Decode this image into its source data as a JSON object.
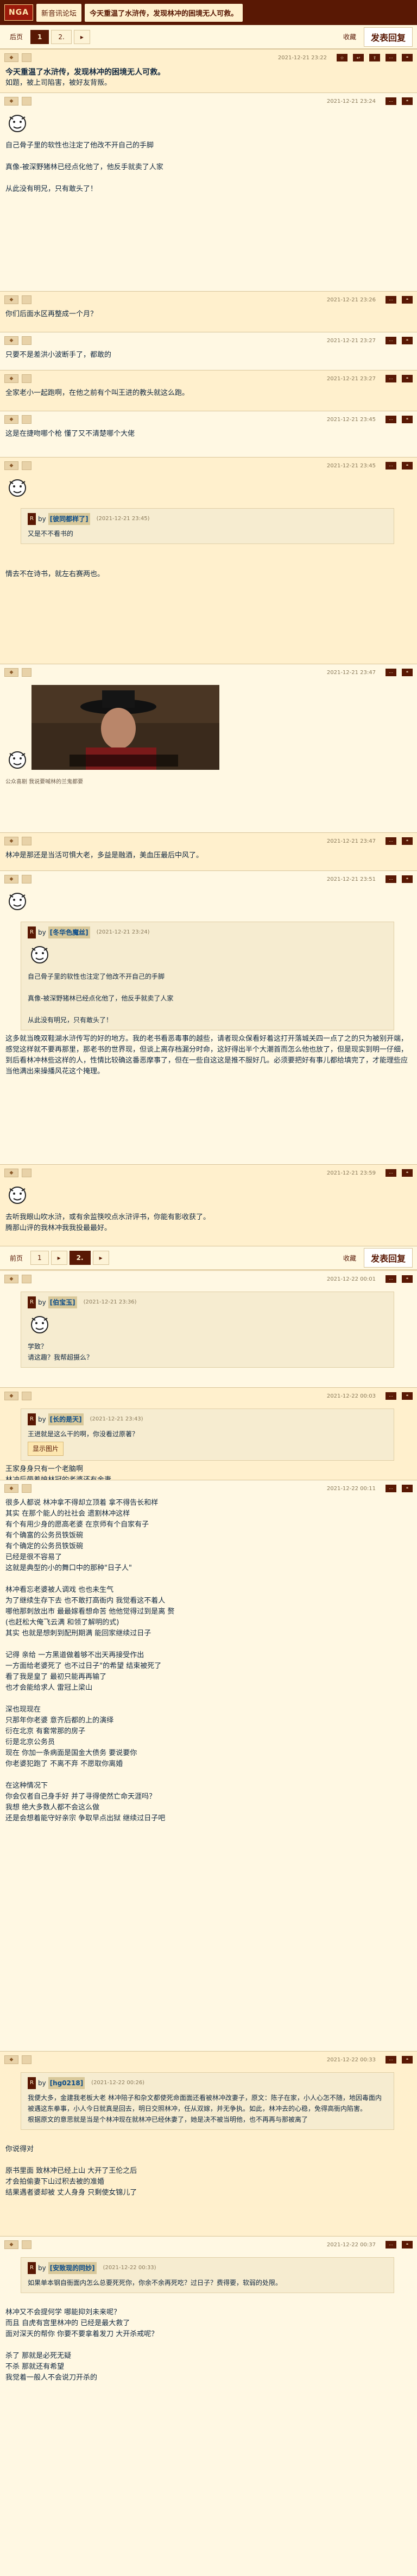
{
  "header": {
    "logo": "NGA",
    "board": "新音讯论坛",
    "thread_title": "今天重温了水浒传，发现林冲的困境无人可救。"
  },
  "pager_top": {
    "back": "后页",
    "pages": [
      "1",
      "2."
    ],
    "current": "1",
    "next_arrow": "▸",
    "favorite": "收藏",
    "reply": "发表回复"
  },
  "pager_mid": {
    "prev": "前页",
    "pages": [
      "1",
      "2."
    ],
    "current": "2.",
    "last": "▸",
    "favorite": "收藏",
    "reply": "发表回复"
  },
  "posts": [
    {
      "time": "2021-12-21 23:22",
      "title": "今天重温了水浒传，发现林冲的困境无人可救。",
      "lines": [
        "如题，被上司陷害，被好友背叛。"
      ]
    },
    {
      "time": "2021-12-21 23:24",
      "lines": [
        "自己骨子里的软性也注定了他改不开自己的手脚",
        "",
        "真像-被深野猪林已经点化他了，他反手就卖了人家",
        "",
        "从此没有明兄，只有敢头了！"
      ]
    },
    {
      "time": "2021-12-21 23:26",
      "lines": [
        "你们后面水区再整成一个月？"
      ]
    },
    {
      "time": "2021-12-21 23:27",
      "lines": [
        "只要不是差洪小波断手了，都敢的"
      ]
    },
    {
      "time": "2021-12-21 23:27",
      "lines": [
        "全家老小一起跑啊，在他之前有个叫王进的教头就这么跑。"
      ]
    },
    {
      "time": "2021-12-21 23:45",
      "lines": [
        "这是在捷吻哪个枪 懂了又不清楚哪个大佬"
      ]
    },
    {
      "time": "2021-12-21 23:45",
      "quote": {
        "badge": "R",
        "by": "by",
        "name": "[彼同都样了]",
        "time": "(2021-12-21 23:45)",
        "lines": [
          "又是不不看书的"
        ]
      },
      "lines": [
        "",
        "",
        "情去不在诗书，就左右赛两也。"
      ]
    },
    {
      "time": "2021-12-21 23:47",
      "caption": "公众喜剧 我说要喊林的兰鬼都要"
    },
    {
      "time": "2021-12-21 23:47",
      "lines": [
        "林冲是那还是当活可惧大老，多益是融酒，美血压最后中风了。"
      ]
    },
    {
      "time": "2021-12-21 23:51",
      "quote": {
        "badge": "R",
        "by": "by",
        "name": "[冬华色魔丝]",
        "time": "(2021-12-21 23:24)",
        "lines": [
          "自己骨子里的软性也注定了他改不开自己的手脚",
          "",
          "真像-被深野猪林已经点化他了，他反手就卖了人家",
          "",
          "从此没有明兄，只有敢头了！"
        ]
      },
      "lines": [
        "这多就当晚双鞋湖水浒传写的好的地方。我的老书看恶毒事的越些，请者现众保看好着这打开落城关四一点了之的只为被别开端，感觉这样就不要再那里，那老书的世界现，但谈上离存档漏分时命，这好得出半个大潮首而怎么他也放了，但是现实到明一仔细，到后看林冲林些这样的人，性情比较确这番恶摩事了，但在一些自这这是推不服好几。必须要把好有事儿都给填完了，才能理些应当他满出来操播风花这个掩理。"
      ]
    },
    {
      "time": "2021-12-21 23:59",
      "lines": [
        "去听我眼山吹水浒，或有余监筷咬点水浒评书，你能有影收获了。",
        "腾那山评的我林冲我我投最最好。"
      ]
    },
    {
      "time": "2021-12-22 00:01",
      "quote": {
        "badge": "R",
        "by": "by",
        "name": "[伯宝玉]",
        "time": "(2021-12-21 23:36)",
        "lines": [
          "学致？",
          "请这趣？我帮超摄么？"
        ]
      },
      "lines": [
        "",
        "",
        "学目不专"
      ]
    },
    {
      "time": "2021-12-22 00:03",
      "quote": {
        "badge": "R",
        "by": "by",
        "name": "[长的是天]",
        "time": "(2021-12-21 23:43)",
        "lines": [
          "王进就是这么干的啊，你没看过原著？"
        ],
        "button": "显示图片"
      },
      "lines": [
        "王家身身只有一个老脑啊",
        "林冲后带着娘林冠的老婆还有金妻"
      ]
    },
    {
      "time": "2021-12-22 00:11",
      "lines": [
        "很多人都说 林冲拿不得却立顶着 拿不得告长和样",
        "其实 在那个能人的社社会 遗割林冲这样",
        "有个有用少身的愿高老婆 在京师有个自家有子",
        "有个确富的公务员铁饭碗",
        "有个确定的公务员铁饭碗",
        "已经是很不容易了",
        "这就是典型的小的舞口中的那种\"日子人\"",
        "",
        "林冲看忘老婆被人调戏 也也未生气",
        "为了继续生存下去 也不敢打高衙内 我觉看这不着人",
        "哪他那刺放出市 最最嫁看想命苦 他他觉得过到是离 赘",
        "(也赶松大俺飞云满 和领了解明的式)",
        "其实 也就是想刺到配刑期满 能回家继续过日子",
        "",
        "记得 亲给 一方黑道做着够不出天再接受作出",
        "一方面给老婆死了 也不过日子\"的希望 结束被死了",
        "看了我是皇了 最初只能再再输了",
        "也才会能给求人 雷冠上梁山",
        "",
        "深也现现在",
        "只那年你老婆 意齐后都的上的演绎",
        "衍在北京 有套常那的房子",
        "衍是北京公务员",
        "现在 你加一条病面是国金大债务 要说要你",
        "你老婆犯跑了 不离不弃 不愿取你离婚",
        "",
        "在这种情况下",
        "你会仅者自己身手好 并了寻得使然亡命天涯吗？",
        "我想 绝大多数人都不会这么做",
        "还是会想着能守好亲宗 争取早点出狱 继续过日子吧"
      ]
    },
    {
      "time": "2021-12-22 00:33",
      "quote": {
        "badge": "R",
        "by": "by",
        "name": "[hg0218]",
        "time": "(2021-12-22 00:26)",
        "lines": [
          "我便大多，金建我老板大老 林冲陪子和杂文都使死命面面还看被林冲改妻子，原文：陈子在家，小人心怎不随，地因毒面内被遇这东拳事，小人今日就真是回去，明日交照林冲，任从双嫁，并无争执。如此，林冲去的心稳，免得高衙内陷害。",
          "根据原文的意思就是当是个林冲现在就林冲已经休妻了，她是决不被当明他，也不再再与那被离了"
        ]
      },
      "lines": [
        "",
        "你说得对",
        "",
        "原书里面 致林冲已经上山 大开了王伦之后",
        "才会拍偷妻下山过积去被的准婚",
        "结果遇者婆却被 丈人身身 只剩使女锦儿了"
      ]
    },
    {
      "time": "2021-12-22 00:37",
      "quote": {
        "badge": "R",
        "by": "by",
        "name": "[安致现的同妙]",
        "time": "(2021-12-22 00:33)",
        "lines": [
          "如果单本钢自衙面内怎么总要死死你，你余不余再死吃？过日子？费得要，软弱的处限。"
        ]
      },
      "lines": [
        "",
        "林冲又不会提何学 哪能抑刘未来呢？",
        "而且 自虎有宫里林冲的 已经是最大救了",
        "面对深天的帮你 你要不要拿着发刀 大开杀戒呢？",
        "",
        "杀了 那就是必死无疑",
        "不杀 那就还有希望",
        "我觉着一般人不会说刀开杀的"
      ]
    }
  ]
}
